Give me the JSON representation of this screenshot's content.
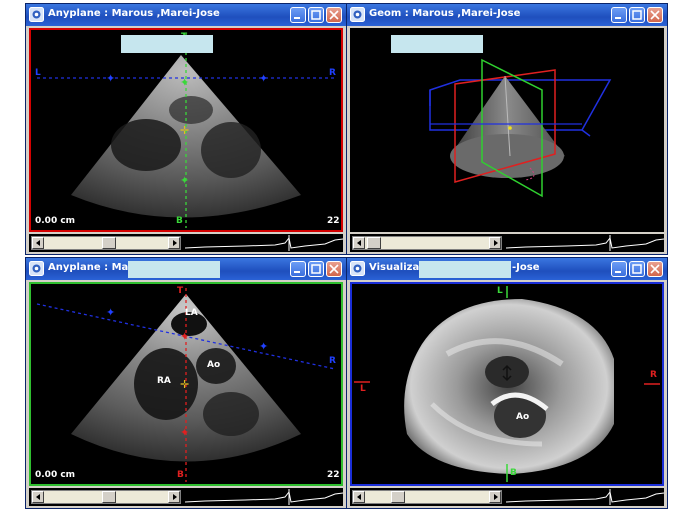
{
  "windows": {
    "w1": {
      "title": "Anyplane : Marous ,Marei-Jose",
      "readout_left": "0.00 cm",
      "readout_right": "22",
      "labels": {
        "left": "L",
        "right": "R",
        "top": "T",
        "bottom": "B"
      }
    },
    "w2": {
      "title": "Geom : Marous ,Marei-Jose"
    },
    "w3": {
      "title": "Anyplane : Maro",
      "readout_left": "0.00 cm",
      "readout_right": "22",
      "labels": {
        "top": "T",
        "bottom": "B",
        "right": "R",
        "la": "LA",
        "ra": "RA",
        "ao": "Ao"
      }
    },
    "w4": {
      "title_start": "Visualizati",
      "title_end": "-Jose",
      "labels": {
        "top": "L",
        "bottom": "B",
        "left": "L",
        "right": "R",
        "ao": "Ao"
      }
    }
  },
  "colors": {
    "titlebar": "#2a62d6",
    "viewport_border_red": "#d40000",
    "viewport_border_green": "#2fbf2f",
    "viewport_border_blue": "#1a2ed8",
    "redaction": "#c6e6ee"
  },
  "icons": [
    "app-icon",
    "minimize-icon",
    "maximize-icon",
    "close-icon",
    "scroll-left-arrow-icon",
    "scroll-right-arrow-icon"
  ]
}
